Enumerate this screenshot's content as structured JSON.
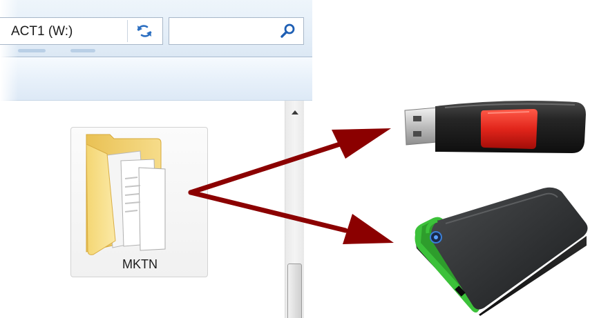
{
  "address_bar": {
    "path": "ACT1 (W:)"
  },
  "search": {
    "value": "",
    "placeholder": ""
  },
  "icons": {
    "refresh": "refresh-icon",
    "search": "search-icon",
    "scroll_up": "scroll-up-arrow-icon",
    "folder": "folder-icon",
    "usb": "usb-flash-drive-icon",
    "hdd": "external-hard-drive-icon"
  },
  "folder": {
    "name": "MKTN"
  },
  "colors": {
    "arrow": "#8b0000",
    "folder_yellow": "#f3d46b",
    "usb_slider": "#e1251b",
    "hdd_accent": "#3cc13a",
    "hdd_body": "#2d2f31"
  }
}
